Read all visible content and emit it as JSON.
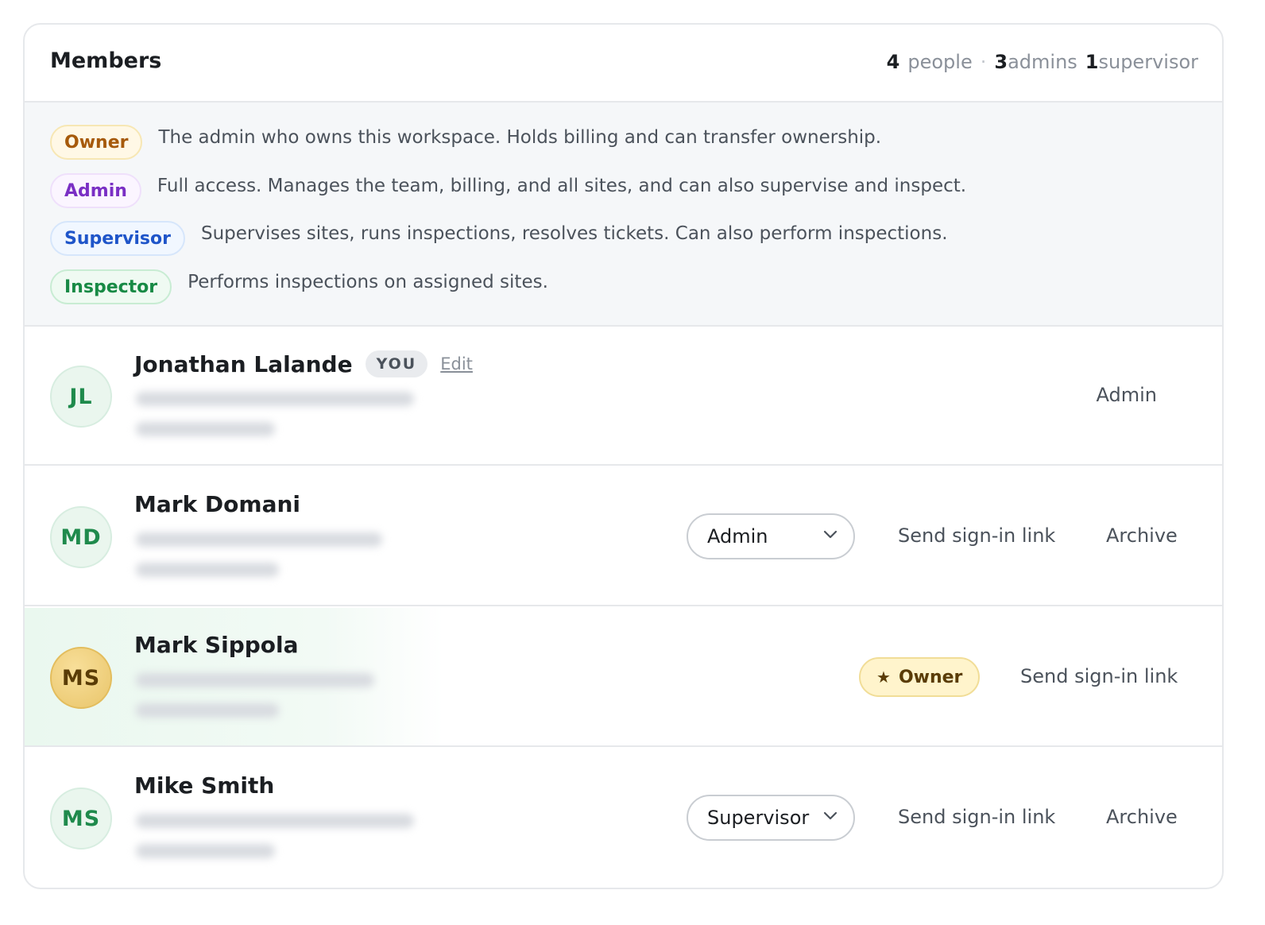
{
  "header": {
    "title": "Members",
    "stats": {
      "people_count": "4",
      "people_label": "people",
      "separator": "·",
      "admins_count": "3",
      "admins_label": "admins",
      "supervisor_count": "1",
      "supervisor_label": "supervisor"
    }
  },
  "legend": [
    {
      "role": "Owner",
      "description": "The admin who owns this workspace. Holds billing and can transfer ownership."
    },
    {
      "role": "Admin",
      "description": "Full access. Manages the team, billing, and all sites, and can also supervise and inspect."
    },
    {
      "role": "Supervisor",
      "description": "Supervises sites, runs inspections, resolves tickets. Can also perform inspections."
    },
    {
      "role": "Inspector",
      "description": "Performs inspections on assigned sites."
    }
  ],
  "members": [
    {
      "initials": "JL",
      "name": "Jonathan Lalande",
      "you_tag": "YOU",
      "edit_label": "Edit",
      "role": "Admin"
    },
    {
      "initials": "MD",
      "name": "Mark Domani",
      "role": "Admin",
      "send_link_label": "Send sign-in link",
      "archive_label": "Archive"
    },
    {
      "initials": "MS",
      "name": "Mark Sippola",
      "role": "Owner",
      "send_link_label": "Send sign-in link"
    },
    {
      "initials": "MS",
      "name": "Mike Smith",
      "role": "Supervisor",
      "send_link_label": "Send sign-in link",
      "archive_label": "Archive"
    }
  ],
  "icons": {
    "dropdown": "chevron-down-icon",
    "owner": "star-icon"
  },
  "colors": {
    "owner": "#a65a0b",
    "admin": "#7a2fc4",
    "supervisor": "#1f55c9",
    "inspector": "#188a45",
    "avatar_text": "#1f8a4c",
    "owner_avatar": "#e9c56a"
  }
}
